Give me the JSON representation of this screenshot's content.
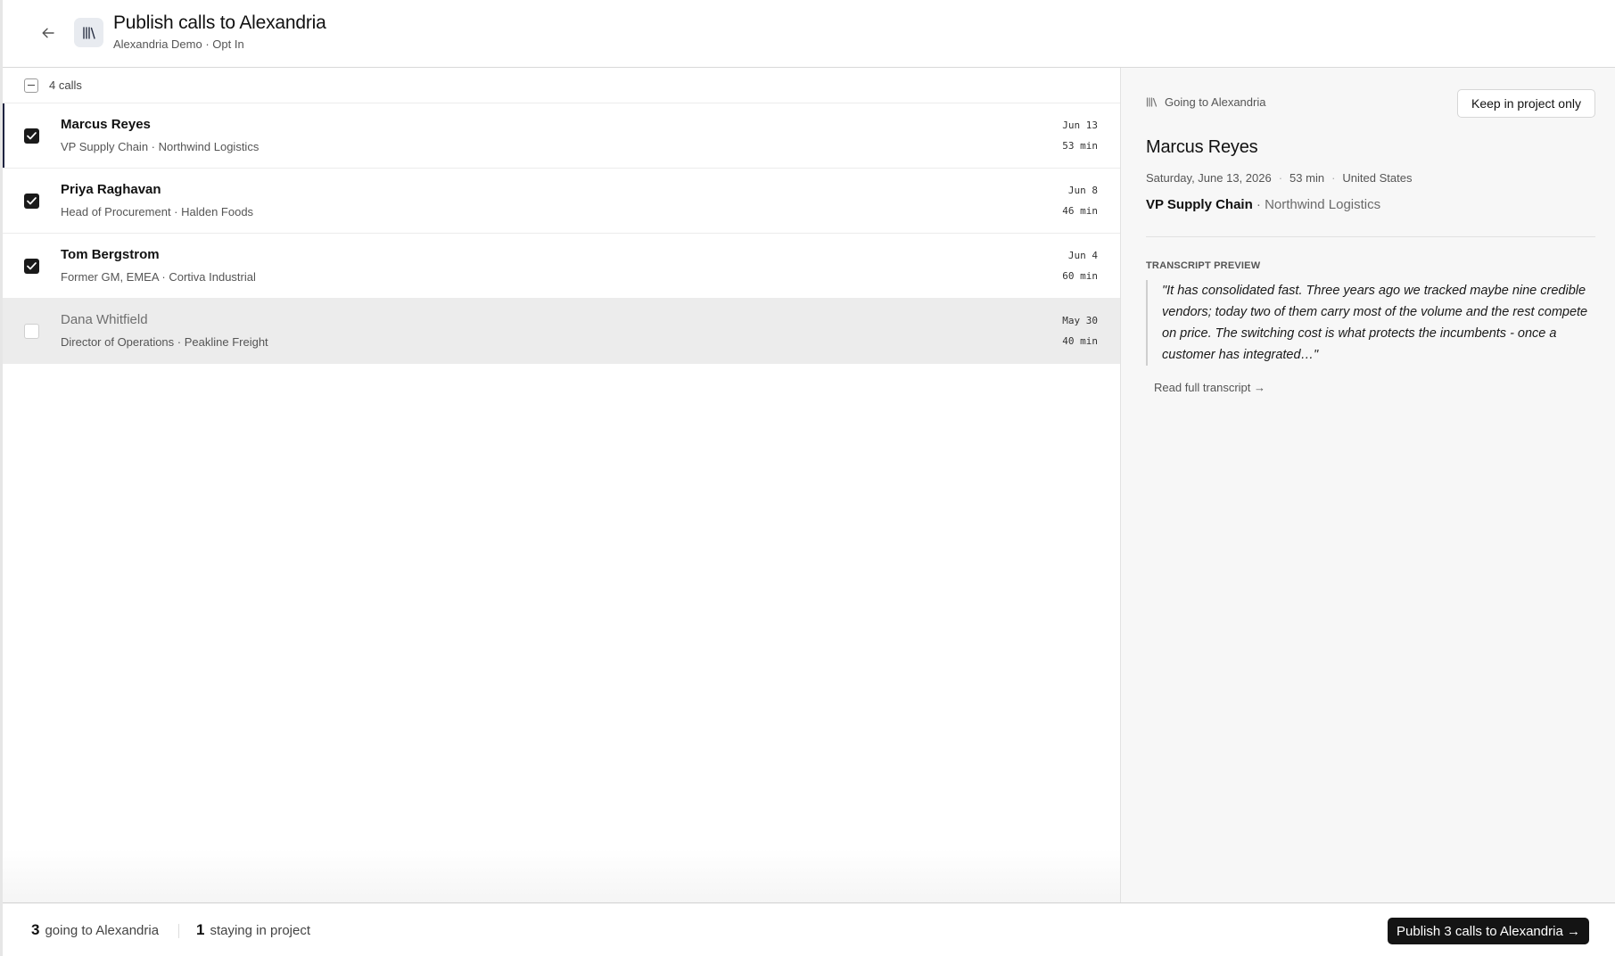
{
  "header": {
    "title": "Publish calls to Alexandria",
    "subtitle": "Alexandria Demo · Opt In",
    "back_icon": "arrow-left-icon",
    "app_icon": "library-icon"
  },
  "list": {
    "count_label": "4 calls",
    "calls": [
      {
        "name": "Marcus Reyes",
        "role": "VP Supply Chain · Northwind Logistics",
        "date": "Jun 13",
        "duration": "53 min",
        "selected": true
      },
      {
        "name": "Priya Raghavan",
        "role": "Head of Procurement · Halden Foods",
        "date": "Jun 8",
        "duration": "46 min",
        "selected": true
      },
      {
        "name": "Tom Bergstrom",
        "role": "Former GM, EMEA · Cortiva Industrial",
        "date": "Jun 4",
        "duration": "60 min",
        "selected": true
      },
      {
        "name": "Dana Whitfield",
        "role": "Director of Operations · Peakline Freight",
        "date": "May 30",
        "duration": "40 min",
        "selected": false
      }
    ]
  },
  "detail": {
    "status": "Going to Alexandria",
    "keep_button": "Keep in project only",
    "name": "Marcus Reyes",
    "date": "Saturday, June 13, 2026",
    "duration": "53 min",
    "country": "United States",
    "dot": "·",
    "title_role": "VP Supply Chain",
    "company": "· Northwind Logistics",
    "preview_label": "TRANSCRIPT PREVIEW",
    "quote": "\"It has consolidated fast. Three years ago we tracked maybe nine credible vendors; today two of them carry most of the volume and the rest compete on price. The switching cost is what protects the incumbents - once a customer has integrated…\"",
    "read_link": "Read full transcript →"
  },
  "footer": {
    "going_count": "3",
    "going_label": "going to Alexandria",
    "staying_count": "1",
    "staying_label": "staying in project",
    "publish_button": "Publish 3 calls to Alexandria →"
  },
  "colors": {
    "accent": "#1e2340",
    "button_dark": "#141414",
    "panel_bg": "#f7f7f7"
  }
}
